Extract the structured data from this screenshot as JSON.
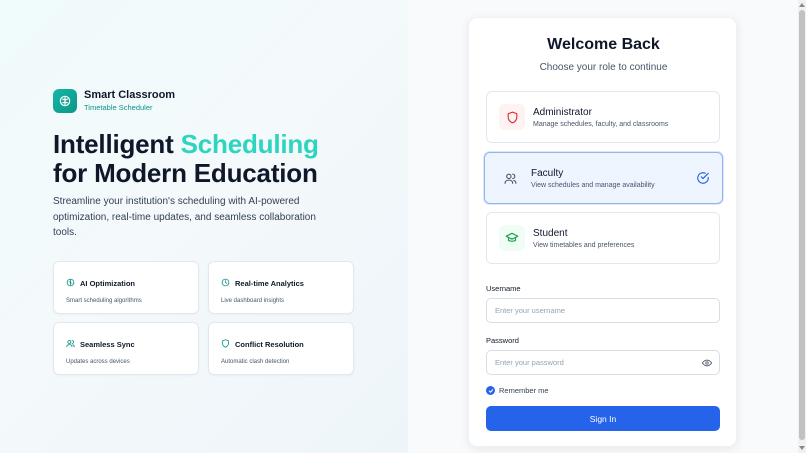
{
  "brand": {
    "title": "Smart Classroom",
    "subtitle": "Timetable Scheduler",
    "icon": "brain-icon"
  },
  "hero": {
    "line1_plain": "Intelligent ",
    "line1_accent": "Scheduling",
    "line2": "for Modern Education",
    "description": "Streamline your institution's scheduling with AI-powered optimization, real-time updates, and seamless collaboration tools."
  },
  "features": [
    {
      "title": "AI Optimization",
      "desc": "Smart scheduling algorithms",
      "icon": "brain-icon"
    },
    {
      "title": "Real-time Analytics",
      "desc": "Live dashboard insights",
      "icon": "clock-icon"
    },
    {
      "title": "Seamless Sync",
      "desc": "Updates across devices",
      "icon": "users-icon"
    },
    {
      "title": "Conflict Resolution",
      "desc": "Automatic clash detection",
      "icon": "shield-icon"
    }
  ],
  "login": {
    "title": "Welcome Back",
    "subtitle": "Choose your role to continue",
    "roles": [
      {
        "title": "Administrator",
        "desc": "Manage schedules, faculty, and classrooms",
        "icon": "shield-icon",
        "selected": false
      },
      {
        "title": "Faculty",
        "desc": "View schedules and manage availability",
        "icon": "users-icon",
        "selected": true
      },
      {
        "title": "Student",
        "desc": "View timetables and preferences",
        "icon": "graduation-cap-icon",
        "selected": false
      }
    ],
    "username": {
      "label": "Username",
      "placeholder": "Enter your username",
      "value": ""
    },
    "password": {
      "label": "Password",
      "placeholder": "Enter your password",
      "value": ""
    },
    "remember_label": "Remember me",
    "remember_checked": true,
    "submit_label": "Sign In"
  },
  "colors": {
    "accent": "#2dd4bf",
    "brand": "#14b8a6",
    "primary": "#2563eb",
    "admin_icon": "#dc2626",
    "student_icon": "#16a34a"
  }
}
